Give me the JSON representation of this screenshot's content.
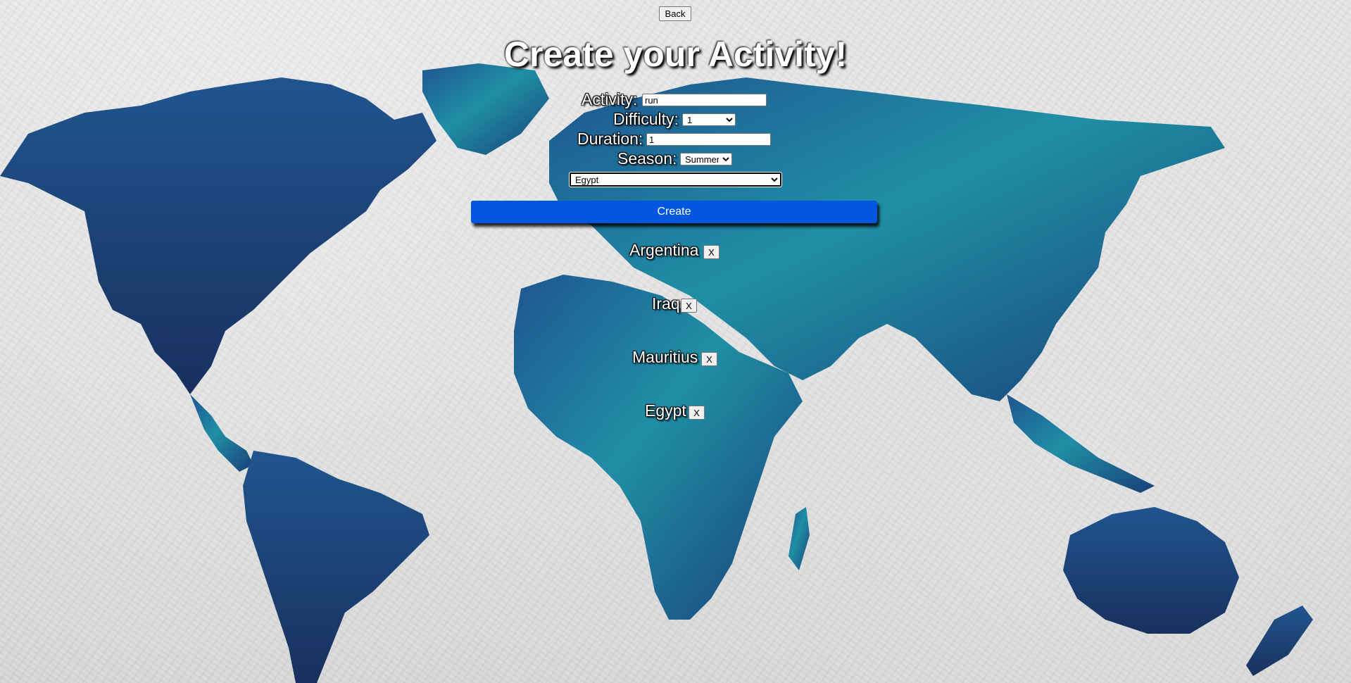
{
  "nav": {
    "back_label": "Back"
  },
  "page": {
    "title": "Create your Activity!"
  },
  "form": {
    "activity_label": "Activity:",
    "activity_value": "run",
    "difficulty_label": "Difficulty:",
    "difficulty_selected": "1",
    "duration_label": "Duration:",
    "duration_value": "1",
    "season_label": "Season:",
    "season_selected": "Summer",
    "country_selected": "Egypt",
    "create_label": "Create"
  },
  "countries": [
    {
      "name": "Argentina",
      "remove_label": "X"
    },
    {
      "name": "Iraq",
      "remove_label": "X"
    },
    {
      "name": "Mauritius",
      "remove_label": "X"
    },
    {
      "name": "Egypt",
      "remove_label": "X"
    }
  ],
  "colors": {
    "accent": "#0356e0",
    "ocean_teal": "#1f8fa5",
    "dark_navy": "#1c3f73"
  },
  "background": {
    "image": "crumpled-paper-world-map"
  }
}
